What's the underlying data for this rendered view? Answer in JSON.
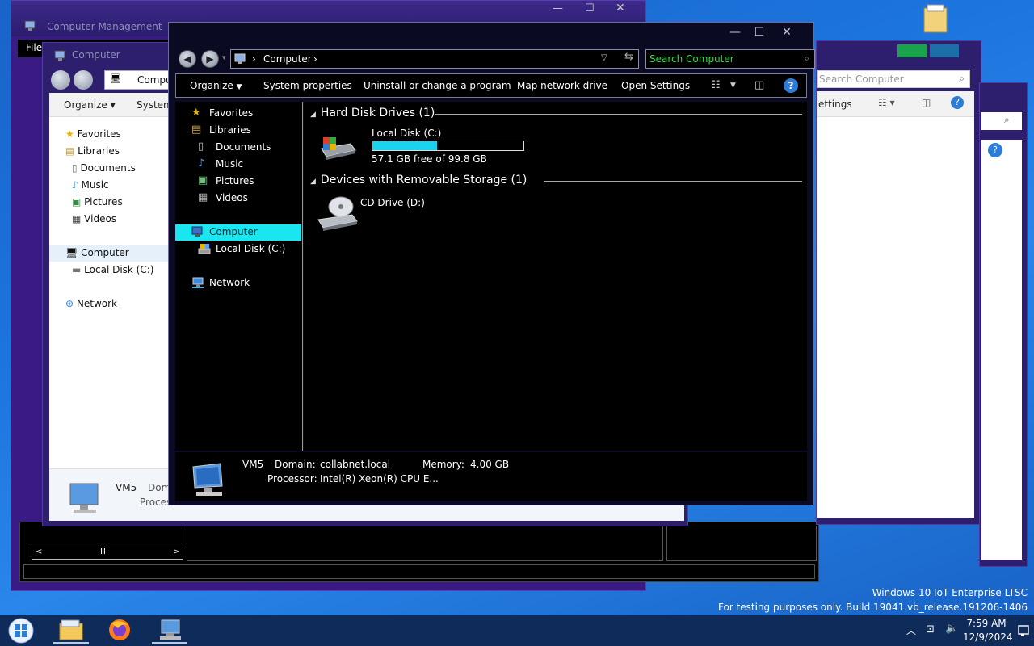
{
  "back_window_1": {
    "title": "Computer Management",
    "menu": "File"
  },
  "back_window_2": {
    "title": "Computer",
    "address": "Compu",
    "organize": "Organize",
    "system": "System",
    "nav": [
      "Favorites",
      "Libraries",
      "Documents",
      "Music",
      "Pictures",
      "Videos",
      "Computer",
      "Local Disk (C:)",
      "Network"
    ],
    "footer_name": "VM5",
    "footer_domain": "Dom",
    "footer_proc": "Proces"
  },
  "back_window_3": {
    "search_placeholder": "Search Computer",
    "settings": "ettings"
  },
  "main": {
    "address": {
      "location": "Computer"
    },
    "search": {
      "placeholder": "Search Computer"
    },
    "commands": {
      "organize": "Organize",
      "system_properties": "System properties",
      "uninstall": "Uninstall or change a program",
      "map_drive": "Map network drive",
      "open_settings": "Open Settings"
    },
    "nav": {
      "favorites": "Favorites",
      "libraries": "Libraries",
      "documents": "Documents",
      "music": "Music",
      "pictures": "Pictures",
      "videos": "Videos",
      "computer": "Computer",
      "local_disk": "Local Disk (C:)",
      "network": "Network"
    },
    "groups": {
      "hdd_header": "Hard Disk Drives (1)",
      "removable_header": "Devices with Removable Storage (1)"
    },
    "drives": {
      "c_name": "Local Disk (C:)",
      "c_free": "57.1 GB free of 99.8 GB",
      "c_used_fraction": 0.428,
      "d_name": "CD Drive (D:)"
    },
    "details": {
      "name": "VM5",
      "domain_label": "Domain:",
      "domain_value": "collabnet.local",
      "memory_label": "Memory:",
      "memory_value": "4.00 GB",
      "processor_label": "Processor:",
      "processor_value": "Intel(R) Xeon(R) CPU E..."
    }
  },
  "desktop": {
    "os_line": "Windows 10 IoT Enterprise LTSC",
    "build_line": "For testing purposes only. Build 19041.vb_release.191206-1406"
  },
  "taskbar": {
    "time": "7:59 AM",
    "date": "12/9/2024"
  },
  "colors": {
    "accent_cyan": "#19e6f0",
    "search_green": "#33dd44",
    "taskbar": "#0f2b5a"
  }
}
